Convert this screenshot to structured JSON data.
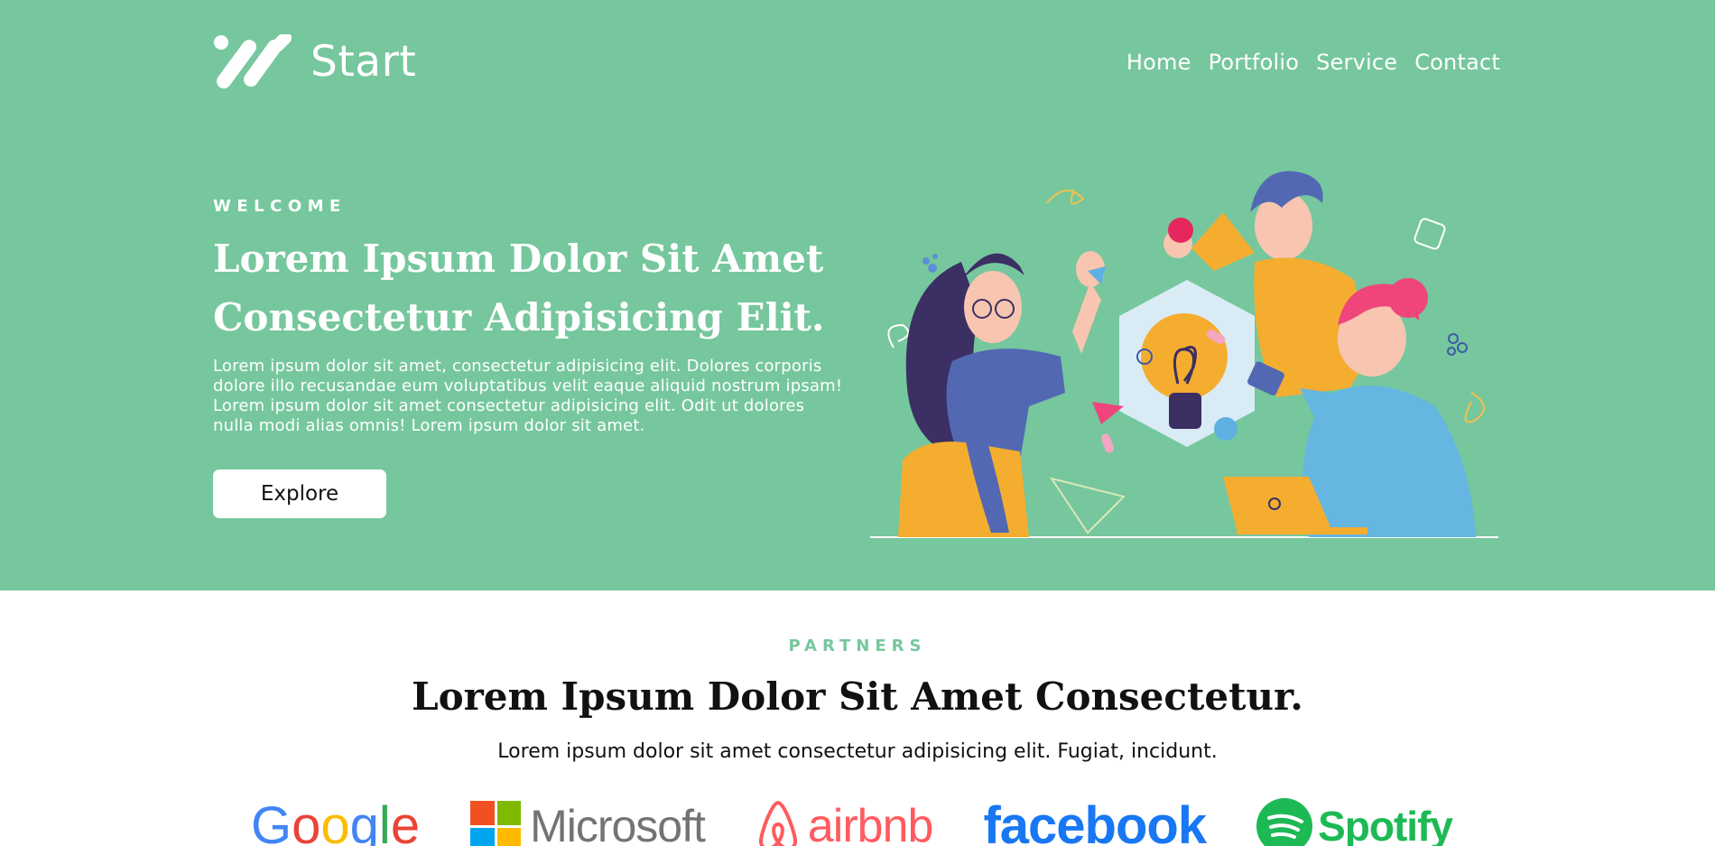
{
  "colors": {
    "hero_bg": "#76c79d",
    "accent": "#76c79d",
    "text_dark": "#111111",
    "white": "#ffffff"
  },
  "header": {
    "logo_icon": "slash-bars-logo-icon",
    "logo_text": "Start",
    "nav": [
      {
        "label": "Home"
      },
      {
        "label": "Portfolio"
      },
      {
        "label": "Service"
      },
      {
        "label": "Contact"
      }
    ]
  },
  "hero": {
    "eyebrow": "WELCOME",
    "title": "Lorem Ipsum Dolor Sit Amet Consectetur Adipisicing Elit.",
    "text": "Lorem ipsum dolor sit amet, consectetur adipisicing elit. Dolores corporis dolore illo recusandae eum voluptatibus velit eaque aliquid nostrum ipsam! Lorem ipsum dolor sit amet consectetur adipisicing elit. Odit ut dolores nulla modi alias omnis! Lorem ipsum dolor sit amet.",
    "button_label": "Explore",
    "illustration": "team-brainstorm-lightbulb-illustration"
  },
  "partners": {
    "eyebrow": "PARTNERS",
    "title": "Lorem Ipsum Dolor Sit Amet Consectetur.",
    "text": "Lorem ipsum dolor sit amet consectetur adipisicing elit. Fugiat, incidunt.",
    "logos": {
      "google": "Google",
      "microsoft": "Microsoft",
      "airbnb": "airbnb",
      "facebook": "facebook",
      "spotify": "Spotify"
    }
  }
}
